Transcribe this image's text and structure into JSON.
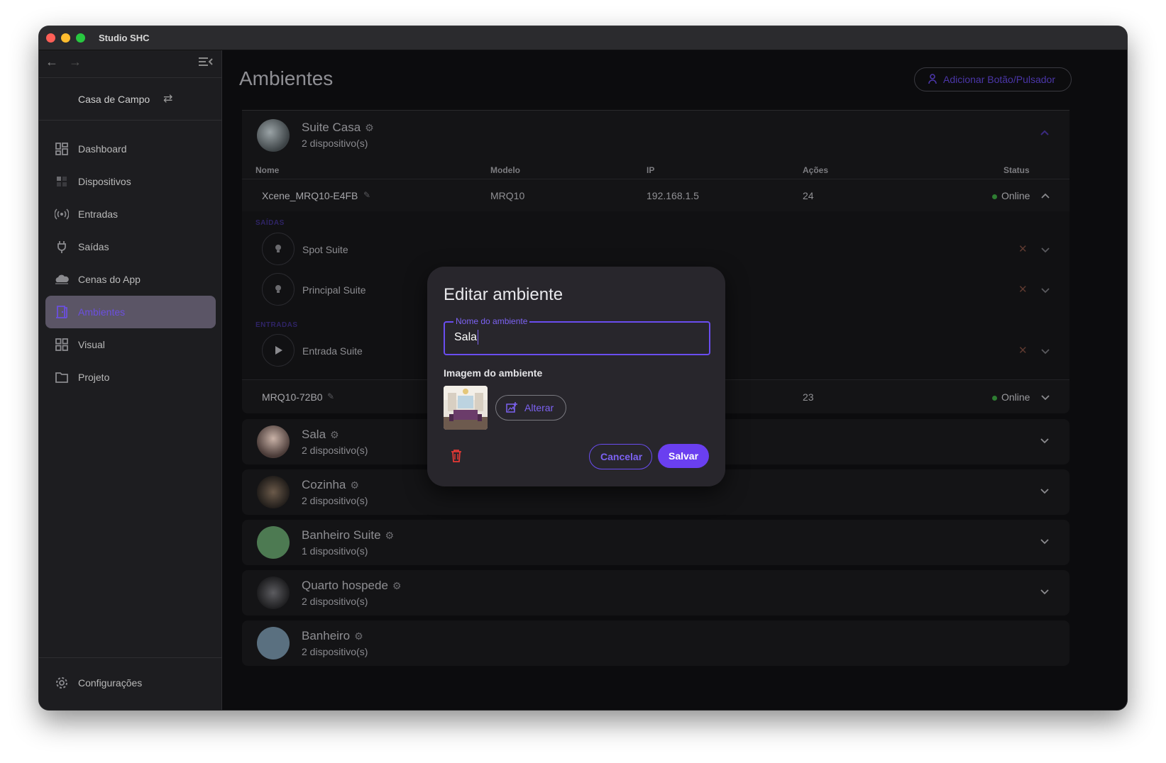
{
  "window": {
    "title": "Studio SHC"
  },
  "sidebar": {
    "project_name": "Casa de Campo",
    "items": [
      {
        "label": "Dashboard",
        "icon": "dashboard-icon",
        "active": false
      },
      {
        "label": "Dispositivos",
        "icon": "devices-icon",
        "active": false
      },
      {
        "label": "Entradas",
        "icon": "inputs-icon",
        "active": false
      },
      {
        "label": "Saídas",
        "icon": "plug-icon",
        "active": false
      },
      {
        "label": "Cenas do App",
        "icon": "cloud-icon",
        "active": false
      },
      {
        "label": "Ambientes",
        "icon": "door-icon",
        "active": true
      },
      {
        "label": "Visual",
        "icon": "grid-icon",
        "active": false
      },
      {
        "label": "Projeto",
        "icon": "folder-icon",
        "active": false
      }
    ],
    "settings_label": "Configurações"
  },
  "main": {
    "title": "Ambientes",
    "add_button_label": "Adicionar Botão/Pulsador",
    "expanded_room": {
      "name": "Suite Casa",
      "count": "2 dispositivo(s)",
      "columns": [
        "Nome",
        "Modelo",
        "IP",
        "Ações",
        "Status"
      ],
      "devices": [
        {
          "name": "Xcene_MRQ10-E4FB",
          "model": "MRQ10",
          "ip": "192.168.1.5",
          "actions": "24",
          "status": "Online"
        },
        {
          "name": "MRQ10-72B0",
          "model": "",
          "ip": "",
          "actions": "23",
          "status": "Online"
        }
      ],
      "outputs_label": "SAÍDAS",
      "inputs_label": "ENTRADAS",
      "outputs": [
        "Spot Suite",
        "Principal Suite"
      ],
      "inputs": [
        "Entrada Suite"
      ]
    },
    "rooms": [
      {
        "name": "Sala",
        "count": "2 dispositivo(s)"
      },
      {
        "name": "Cozinha",
        "count": "2 dispositivo(s)"
      },
      {
        "name": "Banheiro Suite",
        "count": "1 dispositivo(s)"
      },
      {
        "name": "Quarto hospede",
        "count": "2 dispositivo(s)"
      },
      {
        "name": "Banheiro",
        "count": "2 dispositivo(s)"
      }
    ]
  },
  "dialog": {
    "title": "Editar ambiente",
    "field_label": "Nome do ambiente",
    "field_value": "Sala",
    "image_label": "Imagem do ambiente",
    "change_label": "Alterar",
    "cancel_label": "Cancelar",
    "save_label": "Salvar"
  },
  "colors": {
    "accent": "#6a3ff0",
    "online": "#2e7d32",
    "delete": "#e53935"
  }
}
